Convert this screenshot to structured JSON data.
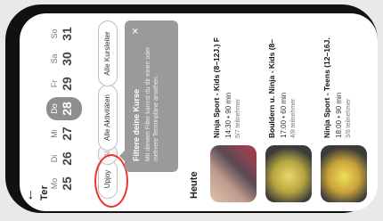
{
  "header": {
    "back_icon": "←",
    "title": "Ter"
  },
  "week": [
    {
      "name": "Mo",
      "date": "25"
    },
    {
      "name": "Di",
      "date": "26"
    },
    {
      "name": "Mi",
      "date": "27"
    },
    {
      "name": "Do",
      "date": "28",
      "active": true
    },
    {
      "name": "Fr",
      "date": "29"
    },
    {
      "name": "Sa",
      "date": "30"
    },
    {
      "name": "So",
      "date": "31"
    }
  ],
  "filters": {
    "upjoy": "Upjoy",
    "all_short": "Al",
    "activities": "Alle Aktivitäten",
    "instructors": "Alle Kursleiter"
  },
  "tooltip": {
    "title": "Filtere deine Kurse",
    "text": "Mit diesem Filter kannst du dir einen oder mehrere Terminpläne ansehen.",
    "close": "×"
  },
  "section_title": "Heute",
  "items": [
    {
      "title": "Ninja Sport - Kids (8–12J.) F",
      "time": "14:30 • 90 min",
      "count": "5/7 teilnehmer"
    },
    {
      "title": "Bouldern u. Ninja - Kids (8–",
      "time": "17:00 • 60 min",
      "count": "4/8 teilnehmer"
    },
    {
      "title": "Ninja Sport - Teens (12–16J.",
      "time": "18:00 • 90 min",
      "count": "3/8 teilnehmer"
    }
  ]
}
